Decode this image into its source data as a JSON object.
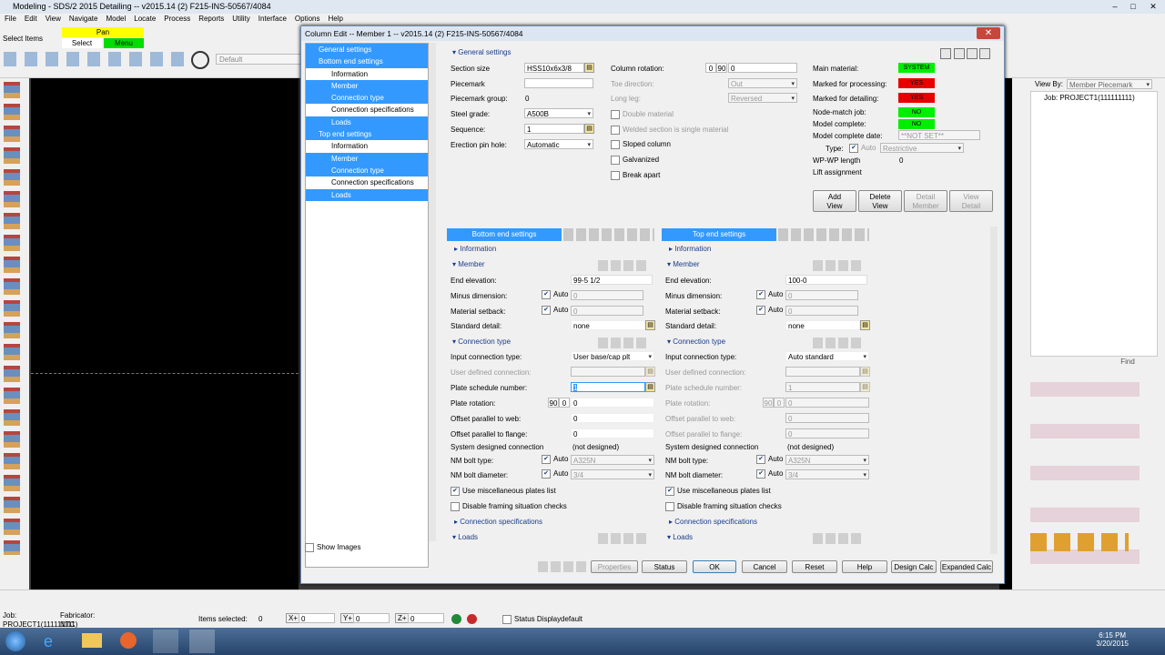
{
  "app": {
    "title": "Modeling - SDS/2 2015 Detailing  -- v2015.14  (2) F215-INS-50567/4084",
    "menu": [
      "File",
      "Edit",
      "View",
      "Navigate",
      "Model",
      "Locate",
      "Process",
      "Reports",
      "Utility",
      "Interface",
      "Options",
      "Help"
    ],
    "select_items_label": "Select Items",
    "mode_pan": "Pan",
    "mode_select": "Select",
    "mode_menu": "Menu",
    "default_label": "Default"
  },
  "dialog": {
    "title": "Column  Edit  --  Member  1  --  v2015.14  (2) F215-INS-50567/4084",
    "nav": [
      {
        "label": "General settings",
        "level": 0,
        "selected": true
      },
      {
        "label": "Bottom end settings",
        "level": 0,
        "selected": true
      },
      {
        "label": "Information",
        "level": 1,
        "selected": false
      },
      {
        "label": "Member",
        "level": 1,
        "selected": true
      },
      {
        "label": "Connection type",
        "level": 1,
        "selected": true
      },
      {
        "label": "Connection specifications",
        "level": 1,
        "selected": false
      },
      {
        "label": "Loads",
        "level": 1,
        "selected": true
      },
      {
        "label": "Top end settings",
        "level": 0,
        "selected": true
      },
      {
        "label": "Information",
        "level": 1,
        "selected": false
      },
      {
        "label": "Member",
        "level": 1,
        "selected": true
      },
      {
        "label": "Connection type",
        "level": 1,
        "selected": true
      },
      {
        "label": "Connection specifications",
        "level": 1,
        "selected": false
      },
      {
        "label": "Loads",
        "level": 1,
        "selected": true
      }
    ],
    "show_images": "Show Images",
    "general": {
      "header": "General settings",
      "section_size_label": "Section size",
      "section_size": "HSS10x6x3/8",
      "piecemark_label": "Piecemark",
      "piecemark_group_label": "Piecemark group:",
      "piecemark_group": "0",
      "steel_grade_label": "Steel grade:",
      "steel_grade": "A500B",
      "sequence_label": "Sequence:",
      "sequence": "1",
      "erection_pin_hole_label": "Erection pin hole:",
      "erection_pin_hole": "Automatic",
      "column_rotation_label": "Column rotation:",
      "column_rotation": "0",
      "rot_0": "0",
      "rot_90": "90",
      "toe_direction_label": "Toe direction:",
      "toe_direction": "Out",
      "long_leg_label": "Long leg:",
      "long_leg": "Reversed",
      "double_material": "Double material",
      "welded_section": "Welded section is single material",
      "sloped_column": "Sloped column",
      "galvanized": "Galvanized",
      "break_apart": "Break apart",
      "main_material_label": "Main material:",
      "main_material": "SYSTEM",
      "marked_processing_label": "Marked for processing:",
      "marked_processing": "YES",
      "marked_detailing_label": "Marked for detailing:",
      "marked_detailing": "YES",
      "node_match_label": "Node-match job:",
      "node_match": "NO",
      "model_complete_label": "Model complete:",
      "model_complete": "NO",
      "model_complete_date_label": "Model complete date:",
      "model_complete_date": "**NOT SET**",
      "type_label": "Type:",
      "type_auto": "Auto",
      "type_value": "Restrictive",
      "wp_wp_label": "WP-WP length",
      "wp_wp": "0",
      "lift_assignment_label": "Lift assignment",
      "add_view": "Add\nView",
      "delete_view": "Delete\nView",
      "detail_member": "Detail\nMember",
      "view_detail": "View\nDetail"
    },
    "bottom": {
      "header": "Bottom end settings",
      "information": "Information",
      "member": "Member",
      "end_elevation_label": "End elevation:",
      "end_elevation": "99-5 1/2",
      "minus_dimension_label": "Minus dimension:",
      "minus_dimension": "0",
      "material_setback_label": "Material setback:",
      "material_setback": "0",
      "auto": "Auto",
      "standard_detail_label": "Standard detail:",
      "standard_detail": "none",
      "connection_type": "Connection type",
      "input_connection_type_label": "Input connection type:",
      "input_connection_type": "User base/cap plt",
      "user_defined_label": "User defined connection:",
      "plate_schedule_label": "Plate schedule number:",
      "plate_schedule": "1",
      "plate_rotation_label": "Plate rotation:",
      "plate_rotation": "0",
      "plate_rot_90": "90",
      "plate_rot_0": "0",
      "offset_web_label": "Offset parallel to web:",
      "offset_web": "0",
      "offset_flange_label": "Offset parallel to flange:",
      "offset_flange": "0",
      "system_designed_label": "System designed connection",
      "system_designed": "(not designed)",
      "nm_bolt_type_label": "NM bolt type:",
      "nm_bolt_type": "A325N",
      "nm_bolt_diameter_label": "NM bolt diameter:",
      "nm_bolt_diameter": "3/4",
      "use_misc": "Use miscellaneous plates list",
      "disable_framing": "Disable framing situation checks",
      "connection_specifications": "Connection specifications",
      "loads": "Loads"
    },
    "top": {
      "header": "Top end settings",
      "information": "Information",
      "member": "Member",
      "end_elevation_label": "End elevation:",
      "end_elevation": "100-0",
      "minus_dimension_label": "Minus dimension:",
      "minus_dimension": "0",
      "material_setback_label": "Material setback:",
      "material_setback": "0",
      "auto": "Auto",
      "standard_detail_label": "Standard detail:",
      "standard_detail": "none",
      "connection_type": "Connection type",
      "input_connection_type_label": "Input connection type:",
      "input_connection_type": "Auto standard",
      "user_defined_label": "User defined connection:",
      "plate_schedule_label": "Plate schedule number:",
      "plate_schedule": "1",
      "plate_rotation_label": "Plate rotation:",
      "plate_rotation": "0",
      "plate_rot_90": "90",
      "plate_rot_0": "0",
      "offset_web_label": "Offset parallel to web:",
      "offset_web": "0",
      "offset_flange_label": "Offset parallel to flange:",
      "offset_flange": "0",
      "system_designed_label": "System designed connection",
      "system_designed": "(not designed)",
      "nm_bolt_type_label": "NM bolt type:",
      "nm_bolt_type": "A325N",
      "nm_bolt_diameter_label": "NM bolt diameter:",
      "nm_bolt_diameter": "3/4",
      "use_misc": "Use miscellaneous plates list",
      "disable_framing": "Disable framing situation checks",
      "connection_specifications": "Connection specifications",
      "loads": "Loads"
    },
    "buttons": {
      "properties": "Properties",
      "status": "Status",
      "ok": "OK",
      "cancel": "Cancel",
      "reset": "Reset",
      "help": "Help",
      "design_calc": "Design Calc",
      "expanded_calc": "Expanded Calc"
    }
  },
  "right_panel": {
    "view_by_label": "View By:",
    "view_by": "Member Piecemark",
    "job": "Job: PROJECT1(111111111)",
    "find": "Find"
  },
  "status": {
    "job_label": "Job:",
    "job": "PROJECT1(111111111)",
    "fabricator_label": "Fabricator:",
    "fabricator": "NTC",
    "items_selected_label": "Items selected:",
    "items_selected": "0",
    "x_label": "X+",
    "x": "0",
    "y_label": "Y+",
    "y": "0",
    "z_label": "Z+",
    "z": "0",
    "status_display_label": "Status Display",
    "status_display": "default"
  },
  "taskbar": {
    "time": "6:15 PM",
    "date": "3/20/2015"
  }
}
